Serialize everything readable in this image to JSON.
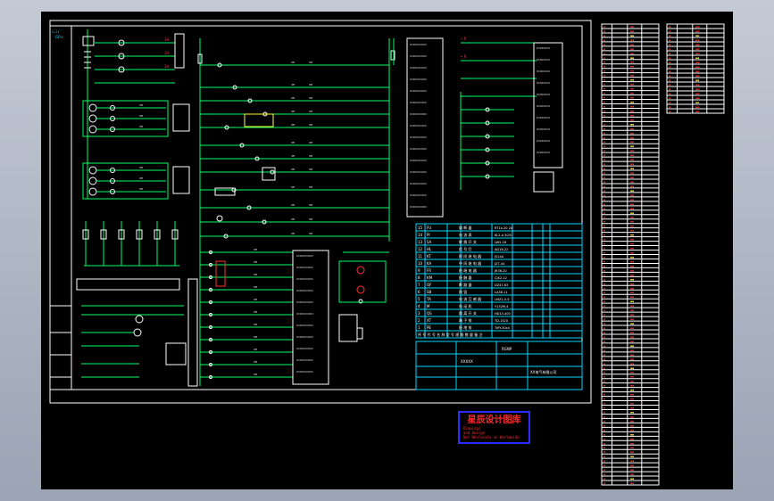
{
  "window": {
    "background_color": "#a7b0bf",
    "canvas_color": "#000000"
  },
  "colors": {
    "border": "#ffffff",
    "wire": "#00ff66",
    "component": "#ffffff",
    "accent_red": "#ff3030",
    "accent_yellow": "#ffff33",
    "table_cyan": "#00d8ff",
    "stamp_blue": "#2b2bff"
  },
  "stamp": {
    "title": "星辰设计图库",
    "line1": "Drawings",
    "line2": "and design",
    "line3": "Net Wholesale on Worldwide"
  },
  "sidebar": {
    "top_label_1": "GP+",
    "top_label_2": "3+13"
  },
  "title_block": {
    "row1": "RGNP",
    "row2": "XXXXX",
    "row3": "XX电气有限公司"
  },
  "parts_list": {
    "rows": [
      {
        "no": "15",
        "code": "FU",
        "name": "熔 断 器",
        "spec": "RT14-20 2A"
      },
      {
        "no": "14",
        "code": "PI",
        "name": "电 流 表",
        "spec": "6L2-A 50/5"
      },
      {
        "no": "13",
        "code": "SA",
        "name": "转 换 开 关",
        "spec": "LW5-16"
      },
      {
        "no": "12",
        "code": "HL",
        "name": "信 号 灯",
        "spec": "AD16-22"
      },
      {
        "no": "11",
        "code": "KT",
        "name": "时 间 继 电 器",
        "spec": "JS14A"
      },
      {
        "no": "10",
        "code": "KA",
        "name": "中 间 继 电 器",
        "spec": "JZ7-44"
      },
      {
        "no": "9",
        "code": "FR",
        "name": "热 继 电 器",
        "spec": "JR36-20"
      },
      {
        "no": "8",
        "code": "KM",
        "name": "接 触 器",
        "spec": "CJX2-12"
      },
      {
        "no": "7",
        "code": "QF",
        "name": "断 路 器",
        "spec": "DZ47-63"
      },
      {
        "no": "6",
        "code": "SB",
        "name": "按 钮",
        "spec": "LA38-11"
      },
      {
        "no": "5",
        "code": "TA",
        "name": "电 流 互 感 器",
        "spec": "LMZ1-0.5"
      },
      {
        "no": "4",
        "code": "M",
        "name": "电 动 机",
        "spec": "Y132M-4"
      },
      {
        "no": "3",
        "code": "QS",
        "name": "隔 离 开 关",
        "spec": "HD13-400"
      },
      {
        "no": "2",
        "code": "XT",
        "name": "端 子 排",
        "spec": "TD-1520"
      },
      {
        "no": "1",
        "code": "PE",
        "name": "接 地 排",
        "spec": "TMY-30x4"
      }
    ],
    "header": "序 号 代 号 名 称 型 号 规 格 数 量 备 注"
  }
}
